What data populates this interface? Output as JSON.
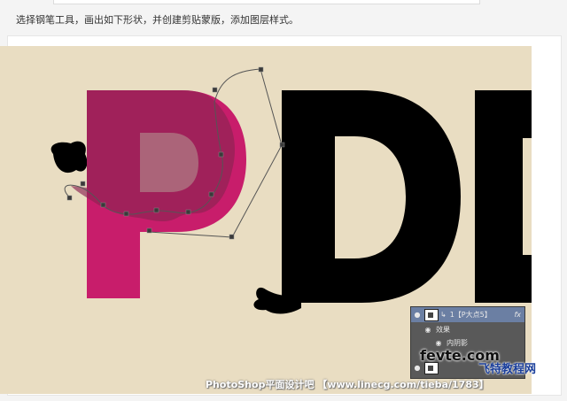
{
  "instruction": "选择钢笔工具，画出如下形状，并创建剪贴蒙版，添加图层样式。",
  "canvas": {
    "background": "#e9ddc2",
    "letter_p_color": "#c81d6b",
    "letter_d_color": "#000000"
  },
  "layers_panel": {
    "layer_name": "1【P大点5】",
    "fx_label": "fx",
    "effects_label": "效果",
    "effect_item": "内阴影",
    "selected_color": "#6b7fa3"
  },
  "watermark": {
    "logo": "fevte.com",
    "cn": "飞特教程网",
    "url": "PhotoShop平面设计吧 【www.linecg.com/tieba/1783】"
  }
}
